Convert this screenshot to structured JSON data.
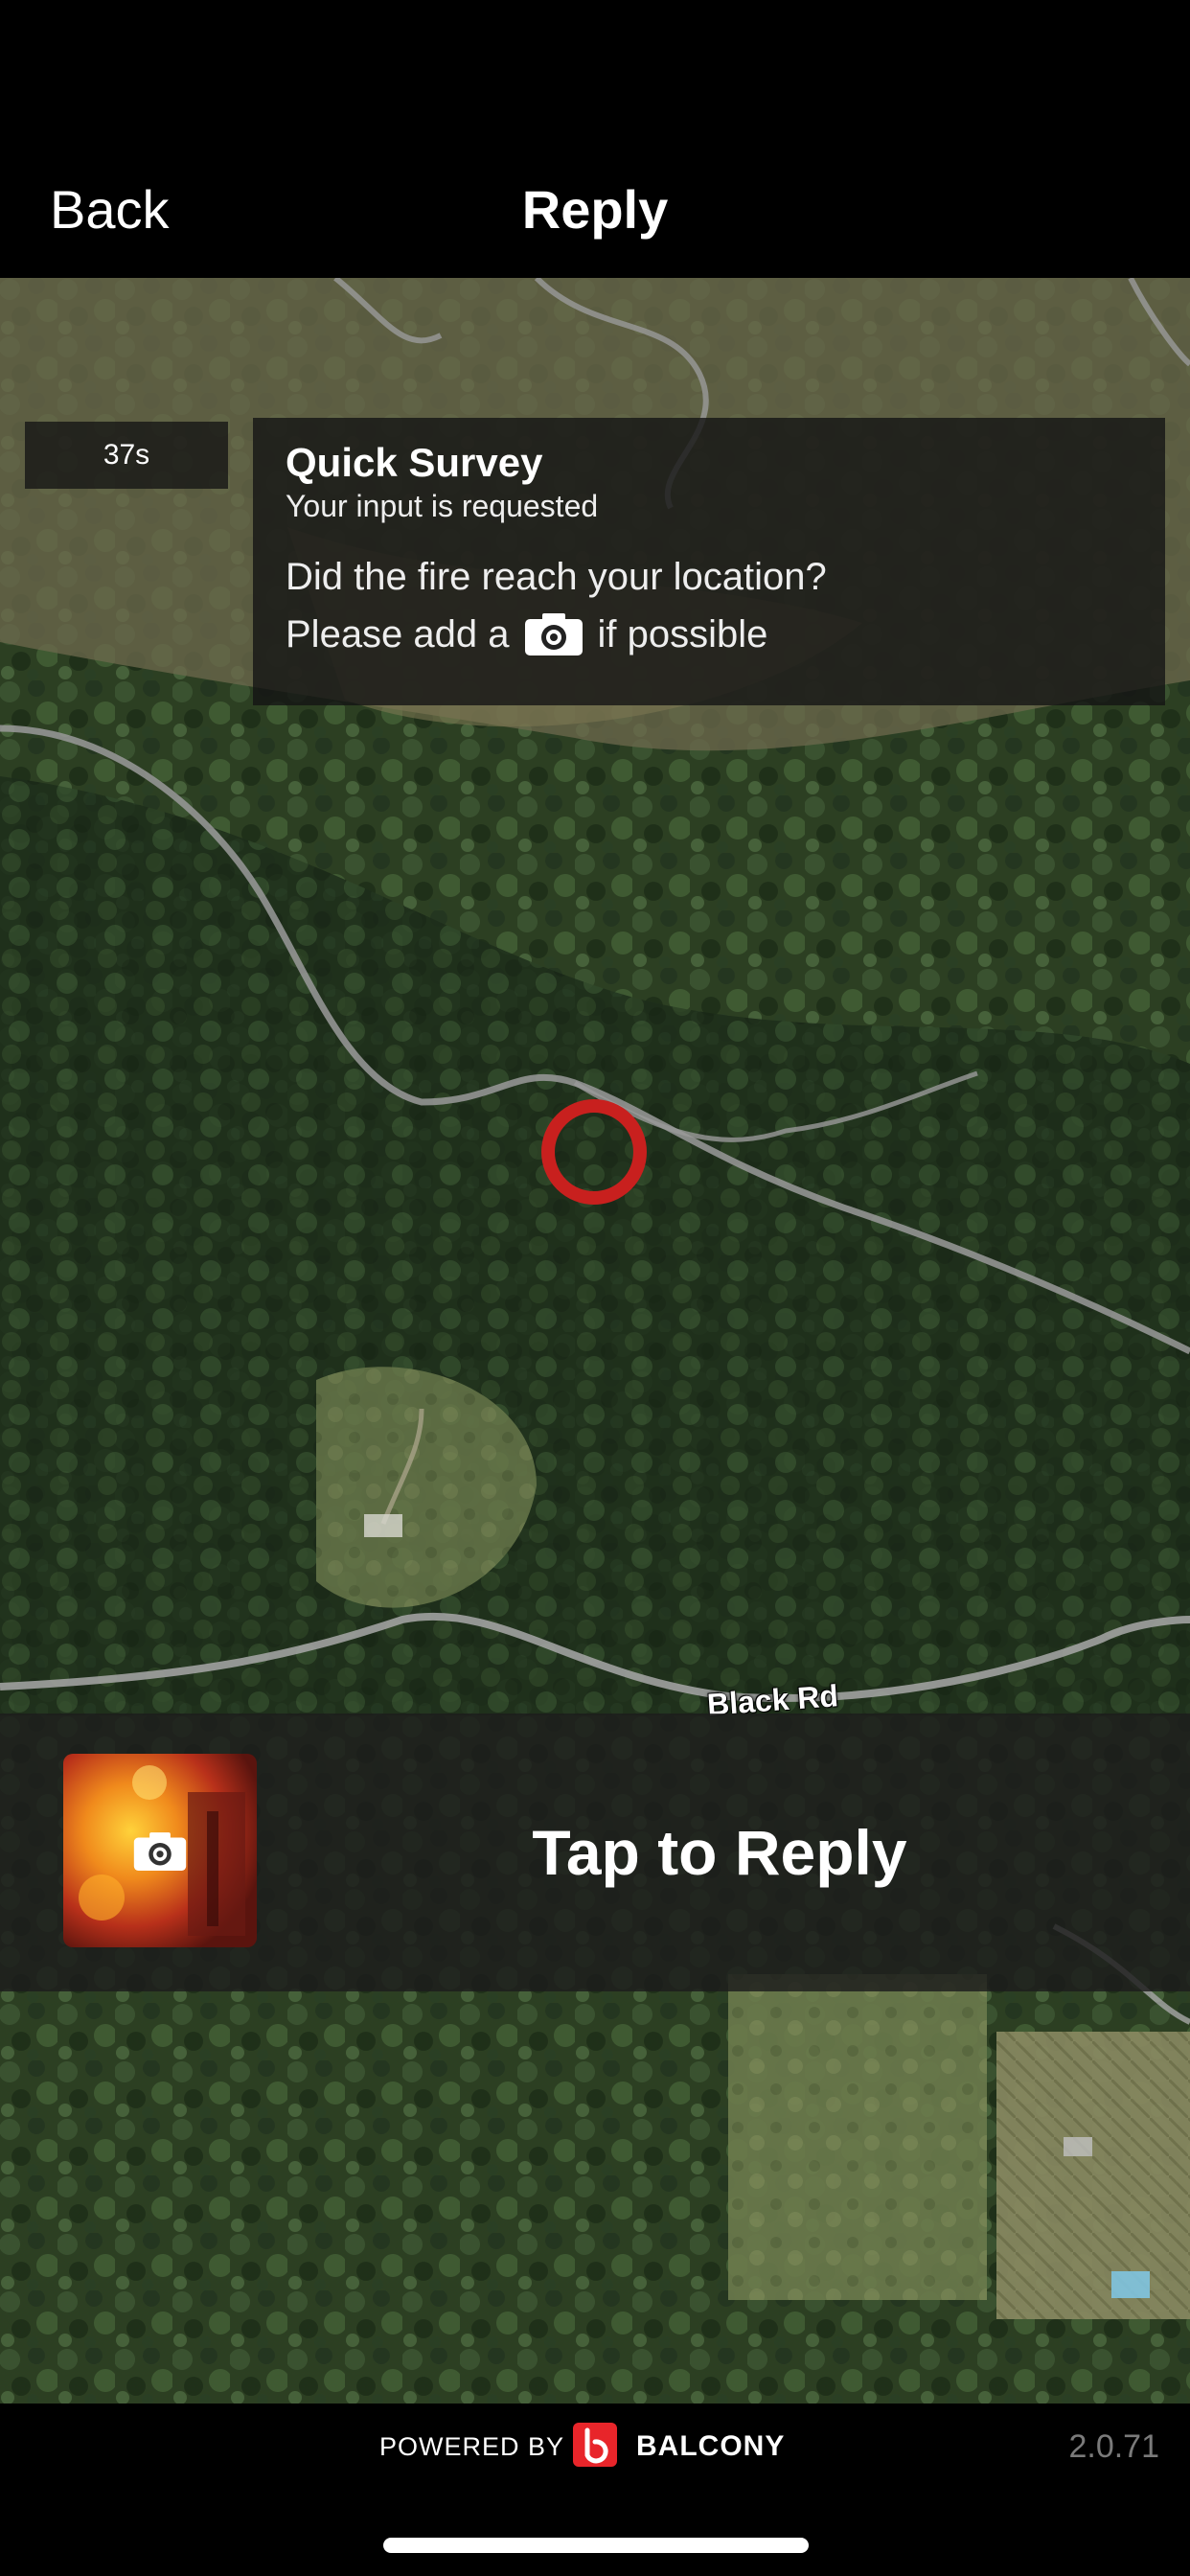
{
  "nav": {
    "back_label": "Back",
    "title": "Reply"
  },
  "timer": {
    "label": "37s"
  },
  "survey": {
    "title": "Quick Survey",
    "subtitle": "Your input is requested",
    "question": "Did the fire reach your location?",
    "instruction_before": "Please add a",
    "instruction_icon": "camera-icon",
    "instruction_after": "if possible"
  },
  "map": {
    "road_label": "Black Rd",
    "marker_color": "#c8201e"
  },
  "reply": {
    "label": "Tap to Reply",
    "thumbnail_icon": "camera-icon"
  },
  "footer": {
    "powered_by": "POWERED BY",
    "brand": "BALCONY",
    "brand_color": "#e8252a",
    "version": "2.0.71"
  }
}
